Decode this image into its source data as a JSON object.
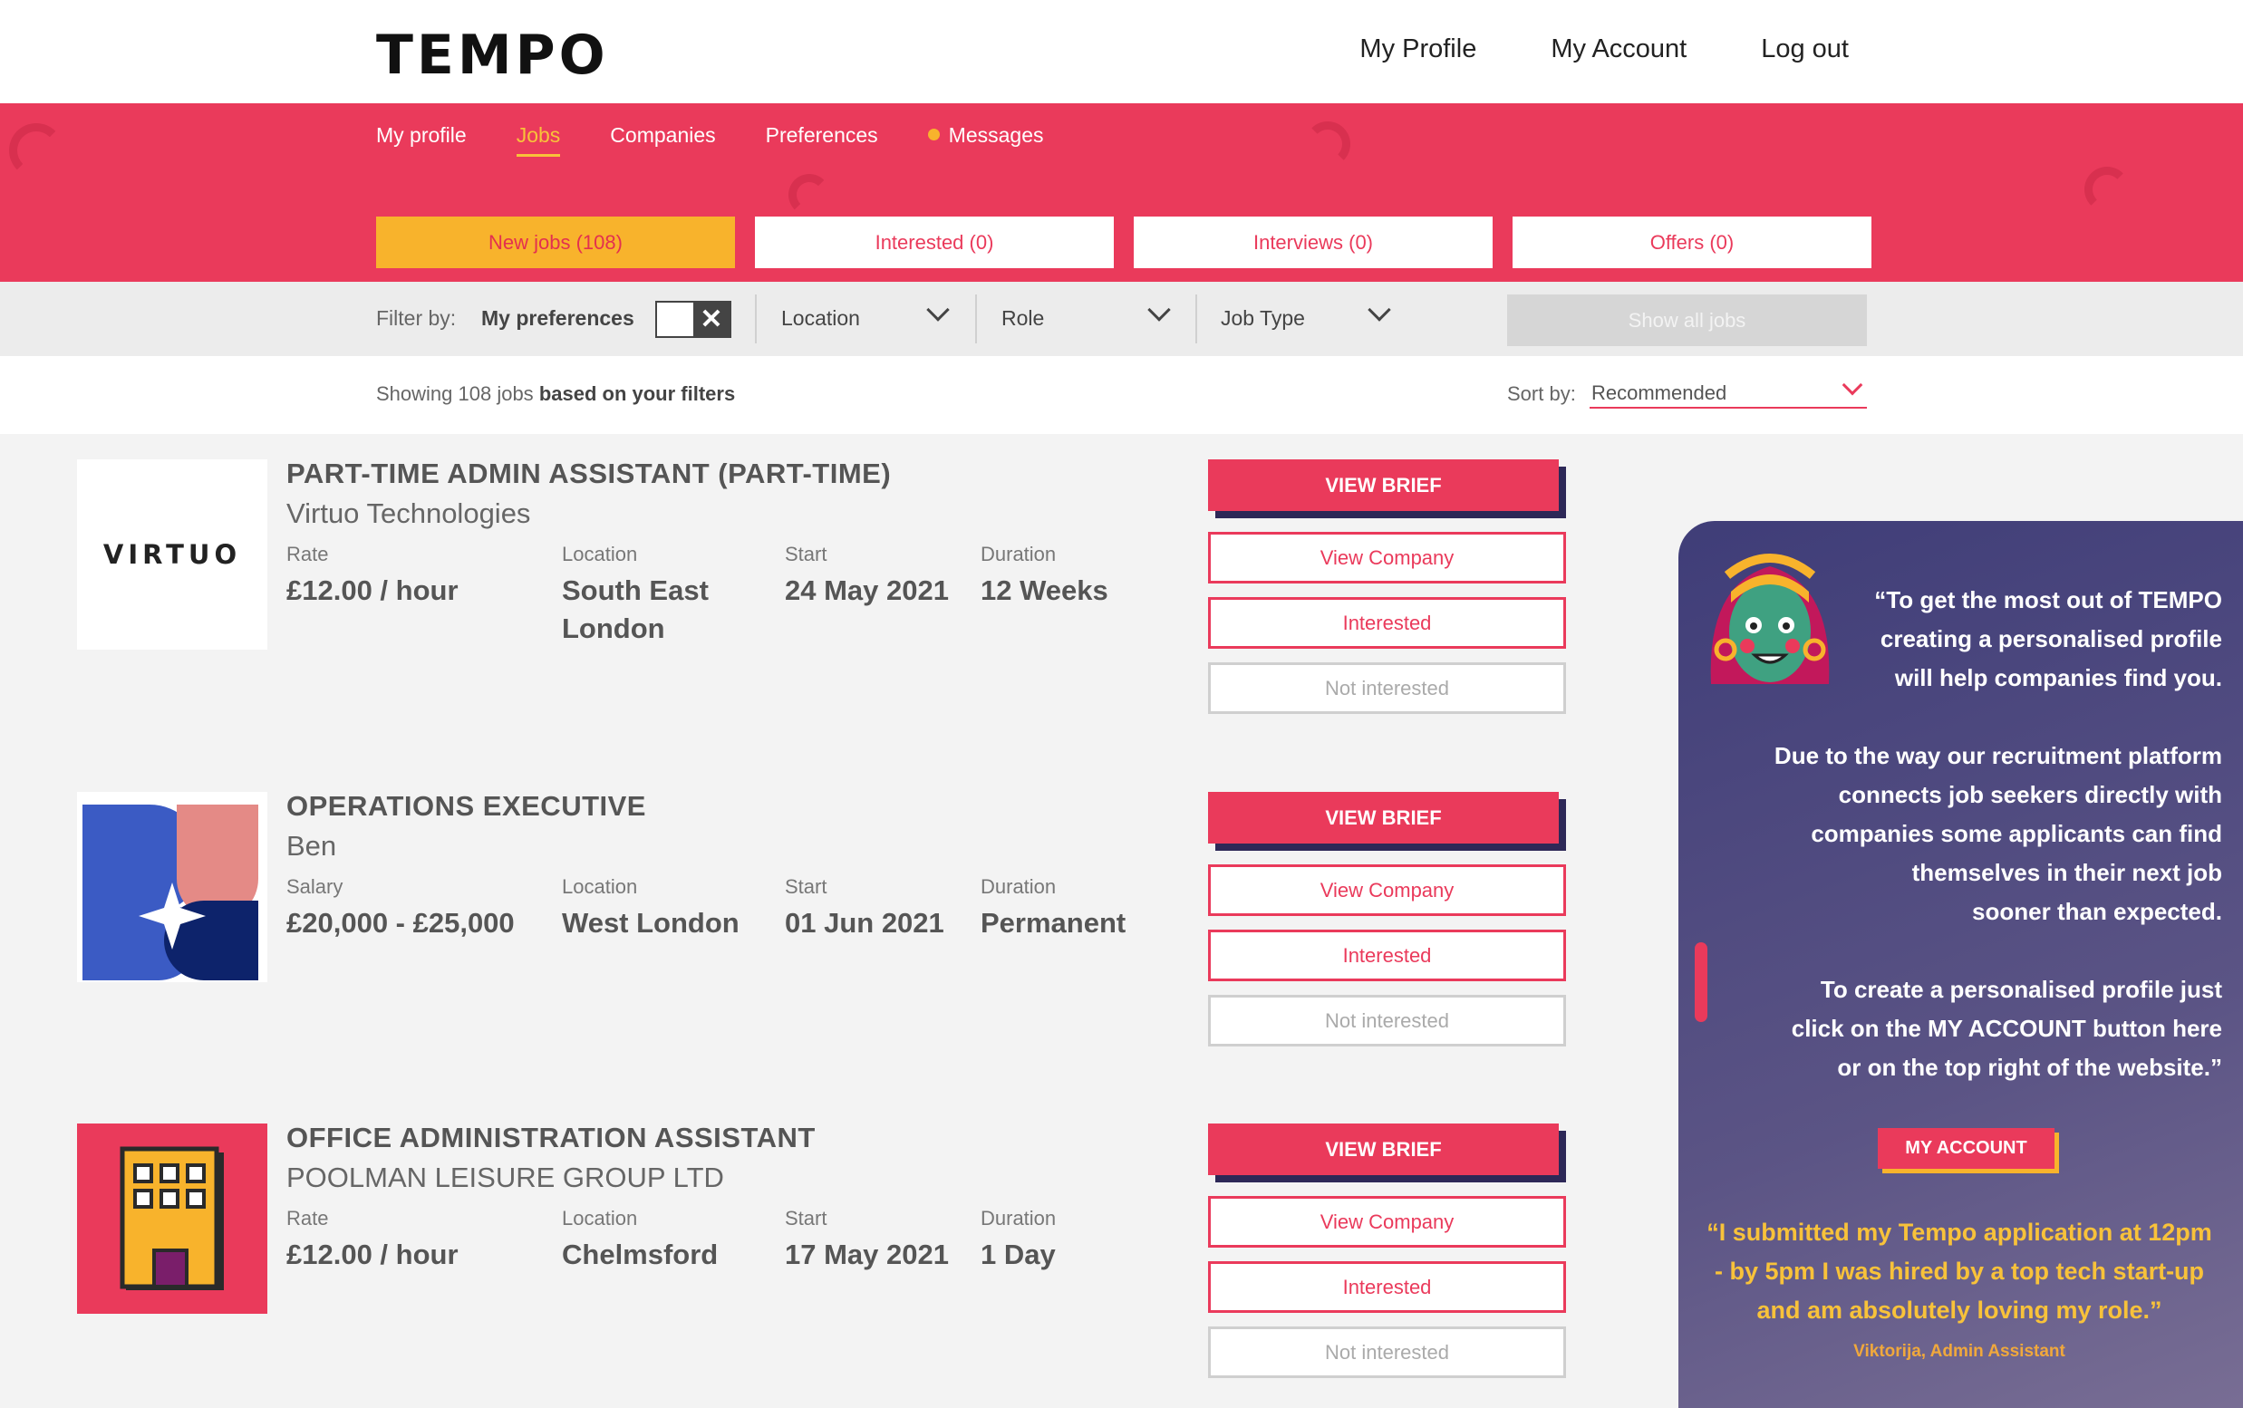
{
  "header": {
    "logo": "TEMPO",
    "nav": [
      "My Profile",
      "My Account",
      "Log out"
    ]
  },
  "subnav": {
    "items": [
      "My profile",
      "Jobs",
      "Companies",
      "Preferences",
      "Messages"
    ],
    "active": "Jobs"
  },
  "tabs": [
    "New jobs (108)",
    "Interested (0)",
    "Interviews (0)",
    "Offers (0)"
  ],
  "filters": {
    "label": "Filter by:",
    "preferences_label": "My preferences",
    "toggle_symbol": "✕",
    "location": "Location",
    "role": "Role",
    "job_type": "Job Type",
    "show_all": "Show all jobs"
  },
  "results": {
    "showing_prefix": "Showing 108 jobs",
    "showing_suffix": "based on your filters",
    "sort_label": "Sort by:",
    "sort_value": "Recommended"
  },
  "buttons": {
    "view_brief": "VIEW BRIEF",
    "view_company": "View Company",
    "interested": "Interested",
    "not_interested": "Not interested"
  },
  "jobs": [
    {
      "title": "PART-TIME ADMIN ASSISTANT (PART-TIME)",
      "company": "Virtuo Technologies",
      "logo_text": "VIRTUO",
      "fields": [
        {
          "label": "Rate",
          "value": "£12.00 / hour"
        },
        {
          "label": "Location",
          "value": "South East London"
        },
        {
          "label": "Start",
          "value": "24 May 2021"
        },
        {
          "label": "Duration",
          "value": "12 Weeks"
        }
      ]
    },
    {
      "title": "OPERATIONS EXECUTIVE",
      "company": "Ben",
      "fields": [
        {
          "label": "Salary",
          "value": "£20,000 - £25,000"
        },
        {
          "label": "Location",
          "value": "West London"
        },
        {
          "label": "Start",
          "value": "01 Jun 2021"
        },
        {
          "label": "Duration",
          "value": "Permanent"
        }
      ]
    },
    {
      "title": "OFFICE ADMINISTRATION ASSISTANT",
      "company": "POOLMAN LEISURE GROUP LTD",
      "fields": [
        {
          "label": "Rate",
          "value": "£12.00 / hour"
        },
        {
          "label": "Location",
          "value": "Chelmsford"
        },
        {
          "label": "Start",
          "value": "17 May 2021"
        },
        {
          "label": "Duration",
          "value": "1 Day"
        }
      ]
    }
  ],
  "panel": {
    "quote_lines": [
      "“To get the most out of TEMPO",
      "creating a personalised profile",
      "will help companies find you."
    ],
    "para2_lines": [
      "Due to the way our recruitment platform",
      "connects job seekers directly with",
      "companies some applicants can find",
      "themselves in their next job",
      "sooner than expected."
    ],
    "para3_lines": [
      "To create a personalised profile just",
      "click on the MY ACCOUNT button here",
      "or on the top right of the website.”"
    ],
    "button": "MY ACCOUNT",
    "testimonial_lines": [
      "“I submitted my Tempo application at 12pm",
      "- by 5pm I was hired by a top tech start-up",
      "and am absolutely loving my role.”"
    ],
    "author": "Viktorija, Admin Assistant"
  },
  "colors": {
    "brand_pink": "#ea3a5b",
    "brand_yellow": "#f8b32c",
    "panel_purple": "#3f3d78"
  }
}
